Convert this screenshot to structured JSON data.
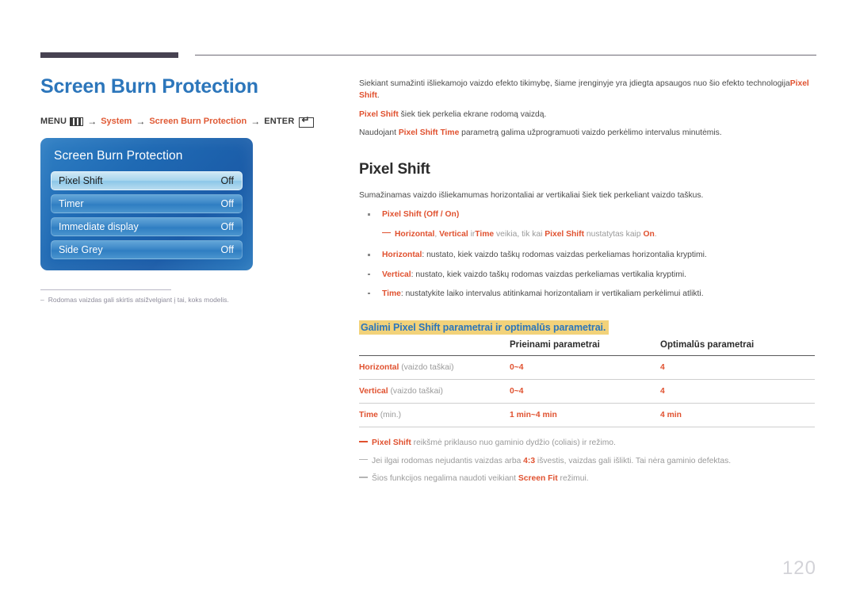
{
  "colors": {
    "title_blue": "#2c76bb",
    "accent_orange": "#e0512f",
    "highlight_yellow": "#f2d27a",
    "rule_dark": "#474251"
  },
  "page_title": "Screen Burn Protection",
  "breadcrumb": {
    "menu_label": "MENU",
    "menu_icon": "menu-grid-icon",
    "arrow": "→",
    "step1": "System",
    "step2": "Screen Burn Protection",
    "enter_label": "ENTER",
    "enter_icon": "enter-key-icon"
  },
  "osd": {
    "title": "Screen Burn Protection",
    "rows": [
      {
        "label": "Pixel Shift",
        "value": "Off",
        "selected": true
      },
      {
        "label": "Timer",
        "value": "Off",
        "selected": false
      },
      {
        "label": "Immediate display",
        "value": "Off",
        "selected": false
      },
      {
        "label": "Side Grey",
        "value": "Off",
        "selected": false
      }
    ]
  },
  "left_note": {
    "dash": "–",
    "text": "Rodomas vaizdas gali skirtis atsižvelgiant į tai, koks modelis."
  },
  "intro": {
    "p1_a": "Siekiant sumažinti išliekamojo vaizdo efekto tikimybę, šiame įrenginyje yra įdiegta apsaugos nuo šio efekto technologija",
    "p1_b": "Pixel Shift",
    "p1_c": ".",
    "p2_a": "Pixel Shift",
    "p2_b": " šiek tiek perkelia ekrane rodomą vaizdą.",
    "p3_a": "Naudojant ",
    "p3_b": "Pixel Shift Time",
    "p3_c": " parametrą galima užprogramuoti vaizdo perkėlimo intervalus minutėmis."
  },
  "section": {
    "title": "Pixel Shift",
    "lead": "Sumažinamas vaizdo išliekamumas horizontaliai ar vertikaliai šiek tiek perkeliant vaizdo taškus.",
    "bullet0": {
      "term": "Pixel Shift",
      "rest": " (Off / On)"
    },
    "subnote0": {
      "t1": "Horizontal",
      "s1": ", ",
      "t2": "Vertical",
      "s2": " ir",
      "t3": "Time",
      "s3": " veikia, tik kai ",
      "t4": "Pixel Shift",
      "s4": " nustatytas kaip ",
      "t5": "On",
      "s5": "."
    },
    "bullet1": {
      "term": "Horizontal",
      "rest": ": nustato, kiek vaizdo taškų rodomas vaizdas perkeliamas horizontalia kryptimi."
    },
    "bullet2": {
      "term": "Vertical",
      "rest": ": nustato, kiek vaizdo taškų rodomas vaizdas perkeliamas vertikalia kryptimi."
    },
    "bullet3": {
      "term": "Time",
      "rest": ": nustatykite laiko intervalus atitinkamai horizontaliam ir vertikaliam perkėlimui atlikti."
    }
  },
  "table": {
    "caption": "Galimi Pixel Shift parametrai ir optimalūs parametrai.",
    "headers": [
      "",
      "Prieinami parametrai",
      "Optimalūs parametrai"
    ],
    "rows": [
      {
        "name": "Horizontal",
        "unit": " (vaizdo taškai)",
        "available": "0~4",
        "optimal": "4"
      },
      {
        "name": "Vertical",
        "unit": " (vaizdo taškai)",
        "available": "0~4",
        "optimal": "4"
      },
      {
        "name": "Time",
        "unit": " (min.)",
        "available": "1 min~4 min",
        "optimal": "4 min"
      }
    ]
  },
  "end_notes": [
    {
      "term": "Pixel Shift",
      "rest": " reikšmė priklauso nuo gaminio dydžio (coliais) ir režimo.",
      "term_first": true
    },
    {
      "pre": "Jei ilgai rodomas nejudantis vaizdas arba ",
      "term": "4:3",
      "rest": " išvestis, vaizdas gali išlikti. Tai nėra gaminio defektas.",
      "term_first": false
    },
    {
      "pre": "Šios funkcijos negalima naudoti veikiant ",
      "term": "Screen Fit",
      "rest": " režimui.",
      "term_first": false
    }
  ],
  "page_number": "120"
}
